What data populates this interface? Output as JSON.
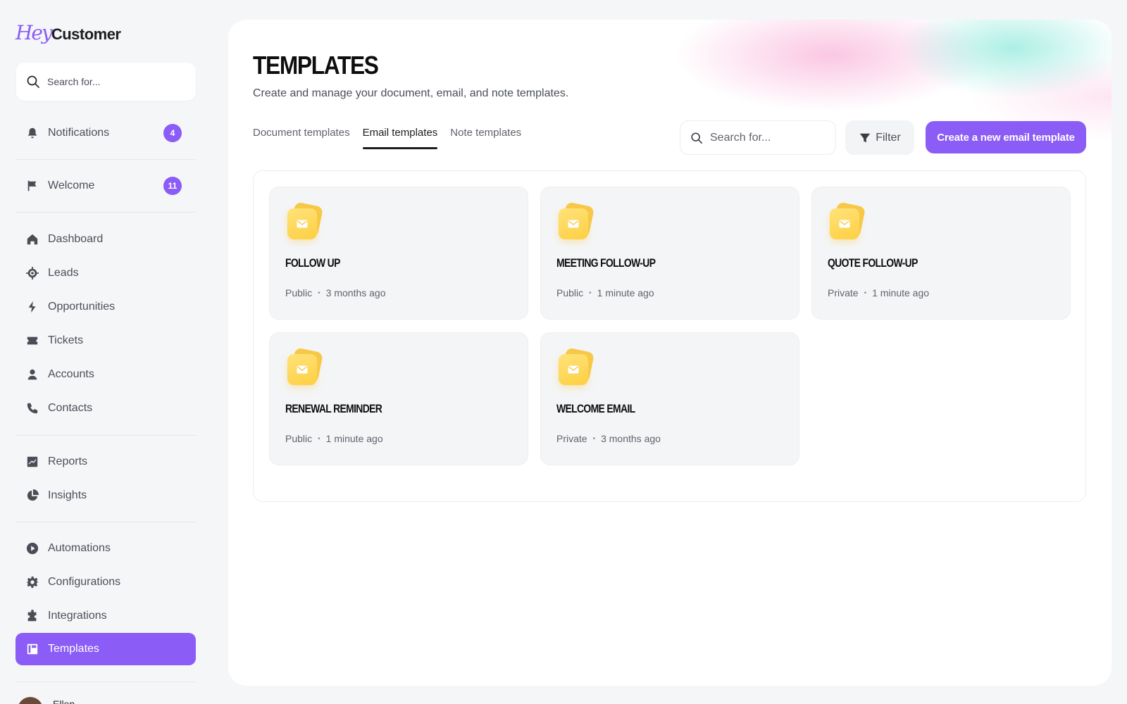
{
  "app": {
    "logo_hey": "Hey",
    "logo_customer": "Customer"
  },
  "sidebar": {
    "search_placeholder": "Search for...",
    "notifications": {
      "label": "Notifications",
      "count": "4"
    },
    "welcome": {
      "label": "Welcome",
      "count": "11"
    },
    "items": [
      {
        "label": "Dashboard",
        "icon": "home-icon"
      },
      {
        "label": "Leads",
        "icon": "target-icon"
      },
      {
        "label": "Opportunities",
        "icon": "bolt-icon"
      },
      {
        "label": "Tickets",
        "icon": "ticket-icon"
      },
      {
        "label": "Accounts",
        "icon": "user-icon"
      },
      {
        "label": "Contacts",
        "icon": "phone-icon"
      },
      {
        "label": "Reports",
        "icon": "chart-icon"
      },
      {
        "label": "Insights",
        "icon": "pie-icon"
      },
      {
        "label": "Automations",
        "icon": "play-icon"
      },
      {
        "label": "Configurations",
        "icon": "gear-icon"
      },
      {
        "label": "Integrations",
        "icon": "puzzle-icon"
      },
      {
        "label": "Templates",
        "icon": "template-icon"
      }
    ],
    "user_name": "Ellen"
  },
  "main": {
    "title": "TEMPLATES",
    "subtitle": "Create and manage your document, email, and note templates.",
    "tabs": [
      {
        "label": "Document templates"
      },
      {
        "label": "Email templates"
      },
      {
        "label": "Note templates"
      }
    ],
    "active_tab": "Email templates",
    "search_placeholder": "Search for...",
    "filter_label": "Filter",
    "create_label": "Create a new email template",
    "templates": [
      {
        "title": "FOLLOW UP",
        "visibility": "Public",
        "updated": "3 months ago"
      },
      {
        "title": "MEETING FOLLOW-UP",
        "visibility": "Public",
        "updated": "1 minute ago"
      },
      {
        "title": "QUOTE FOLLOW-UP",
        "visibility": "Private",
        "updated": "1 minute ago"
      },
      {
        "title": "RENEWAL REMINDER",
        "visibility": "Public",
        "updated": "1 minute ago"
      },
      {
        "title": "WELCOME EMAIL",
        "visibility": "Private",
        "updated": "3 months ago"
      }
    ]
  },
  "colors": {
    "accent": "#8b5cf6",
    "folder": "#fdd042"
  }
}
